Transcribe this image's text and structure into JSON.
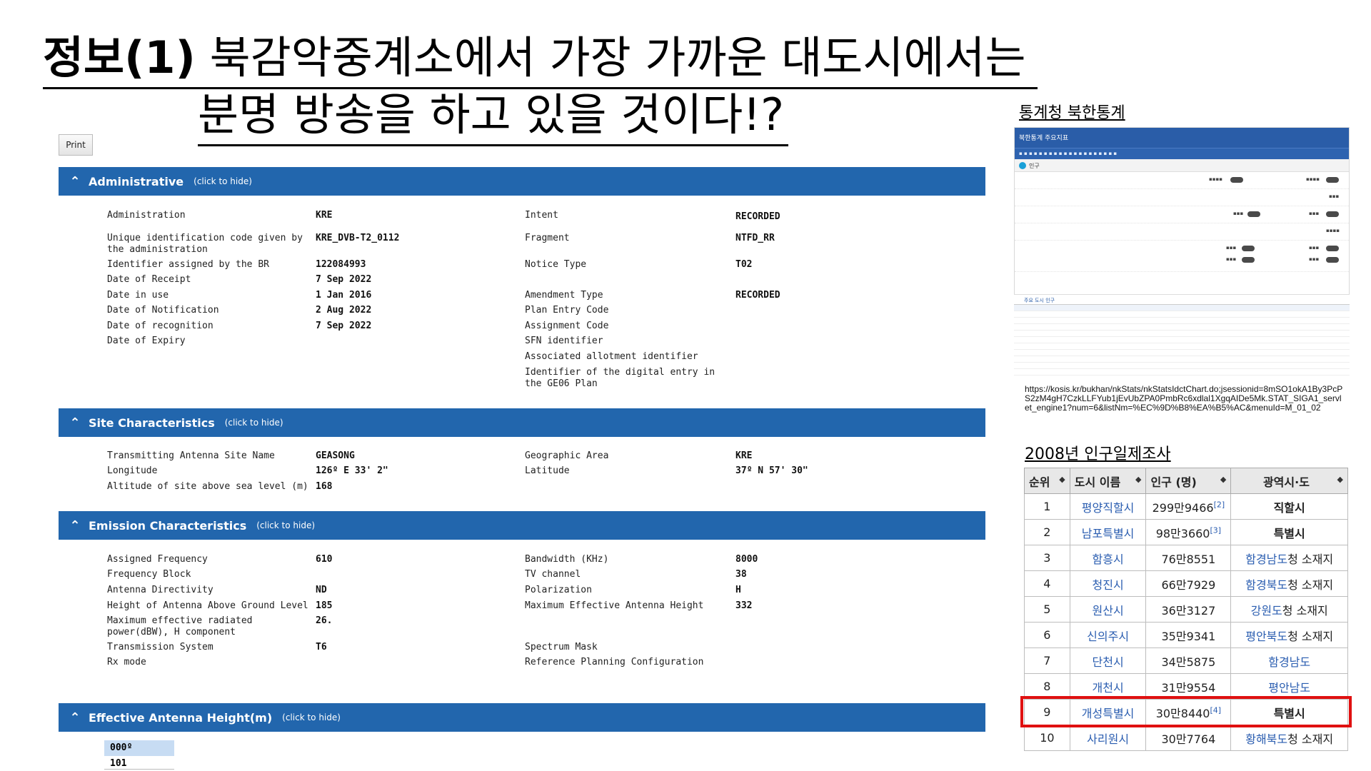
{
  "title": {
    "line1_bold": "정보(1)",
    "line1_rest": " 북감악중계소에서 가장 가까운 대도시에서는",
    "line2": "분명 방송을 하고 있을 것이다!?"
  },
  "document": {
    "print_label": "Print",
    "hide_hint": "(click to hide)",
    "sections": {
      "administrative": "Administrative",
      "site": "Site Characteristics",
      "emission": "Emission Characteristics",
      "eah": "Effective Antenna Height(m)"
    },
    "admin": {
      "administration_label": "Administration",
      "administration_value": "KRE",
      "uid_label": "Unique identification code given by the administration",
      "uid_value": "KRE_DVB-T2_0112",
      "br_label": "Identifier assigned by the BR",
      "br_value": "122084993",
      "receipt_label": "Date of Receipt",
      "receipt_value": "7 Sep 2022",
      "inuse_label": "Date in use",
      "inuse_value": "1 Jan 2016",
      "notification_label": "Date of Notification",
      "notification_value": "2 Aug 2022",
      "recognition_label": "Date of recognition",
      "recognition_value": "7 Sep 2022",
      "expiry_label": "Date of Expiry",
      "intent_label": "Intent",
      "intent_value": "RECORDED",
      "fragment_label": "Fragment",
      "fragment_value": "NTFD_RR",
      "notice_label": "Notice Type",
      "notice_value": "T02",
      "amend_label": "Amendment Type",
      "amend_value": "RECORDED",
      "plan_entry_label": "Plan Entry Code",
      "assign_label": "Assignment Code",
      "sfn_label": "SFN identifier",
      "allot_label": "Associated allotment identifier",
      "ge06_label": "Identifier of the digital entry in the GE06 Plan"
    },
    "site": {
      "name_label": "Transmitting Antenna Site Name",
      "name_value": "GEASONG",
      "lon_label": "Longitude",
      "lon_value": "126º E 33' 2\"",
      "alt_label": "Altitude of site above sea level (m)",
      "alt_value": "168",
      "geo_label": "Geographic Area",
      "geo_value": "KRE",
      "lat_label": "Latitude",
      "lat_value": "37º N 57' 30\""
    },
    "emission": {
      "freq_label": "Assigned Frequency",
      "freq_value": "610",
      "block_label": "Frequency Block",
      "dir_label": "Antenna Directivity",
      "dir_value": "ND",
      "height_label": "Height of Antenna Above Ground Level",
      "height_value": "185",
      "erp_label": "Maximum effective radiated power(dBW), H component",
      "erp_value": "26.",
      "tx_label": "Transmission System",
      "tx_value": "T6",
      "rx_label": "Rx mode",
      "bw_label": "Bandwidth (KHz)",
      "bw_value": "8000",
      "tv_label": "TV channel",
      "tv_value": "38",
      "pol_label": "Polarization",
      "pol_value": "H",
      "meah_label": "Maximum Effective Antenna Height",
      "meah_value": "332",
      "mask_label": "Spectrum Mask",
      "rpc_label": "Reference Planning Configuration"
    },
    "eah": {
      "azimuth": "000º",
      "value": "101"
    }
  },
  "kosis": {
    "link_label": "통계청 북한통계",
    "topbar": "북한통계 주요지표",
    "section": "인구",
    "table_header": "주요 도시 인구",
    "url": "https://kosis.kr/bukhan/nkStats/nkStatsIdctChart.do;jsessionid=8mSO1okA1By3PcPS2zM4gH7CzkLLFYub1jEvUbZPA0PmbRc6xdlal1XgqAIDe5Mk.STAT_SIGA1_servlet_engine1?num=6&listNm=%EC%9D%B8%EA%B5%AC&menuId=M_01_02"
  },
  "census": {
    "title": "2008년 인구일제조사",
    "headers": [
      "순위",
      "도시 이름",
      "인구 (명)",
      "광역시·도"
    ],
    "rows": [
      {
        "rank": "1",
        "city": "평양직할시",
        "pop": "299만9466",
        "ref": "[2]",
        "prov": "직할시"
      },
      {
        "rank": "2",
        "city": "남포특별시",
        "pop": "98만3660",
        "ref": "[3]",
        "prov": "특별시"
      },
      {
        "rank": "3",
        "city": "함흥시",
        "pop": "76만8551",
        "ref": "",
        "prov_link": "함경남도",
        "prov_rest": "청 소재지"
      },
      {
        "rank": "4",
        "city": "청진시",
        "pop": "66만7929",
        "ref": "",
        "prov_link": "함경북도",
        "prov_rest": "청 소재지"
      },
      {
        "rank": "5",
        "city": "원산시",
        "pop": "36만3127",
        "ref": "",
        "prov_link": "강원도",
        "prov_rest": "청 소재지"
      },
      {
        "rank": "6",
        "city": "신의주시",
        "pop": "35만9341",
        "ref": "",
        "prov_link": "평안북도",
        "prov_rest": "청 소재지"
      },
      {
        "rank": "7",
        "city": "단천시",
        "pop": "34만5875",
        "ref": "",
        "prov_link": "함경남도",
        "prov_rest": ""
      },
      {
        "rank": "8",
        "city": "개천시",
        "pop": "31만9554",
        "ref": "",
        "prov_link": "평안남도",
        "prov_rest": ""
      },
      {
        "rank": "9",
        "city": "개성특별시",
        "pop": "30만8440",
        "ref": "[4]",
        "prov": "특별시"
      },
      {
        "rank": "10",
        "city": "사리원시",
        "pop": "30만7764",
        "ref": "",
        "prov_link": "황해북도",
        "prov_rest": "청 소재지"
      }
    ]
  },
  "colors": {
    "section_bar": "#2266ad",
    "highlight": "#e01010",
    "link": "#2a5db0"
  },
  "icons": {
    "section_toggle": "double-chevron-up-icon",
    "sort": "sort-arrows-icon"
  }
}
